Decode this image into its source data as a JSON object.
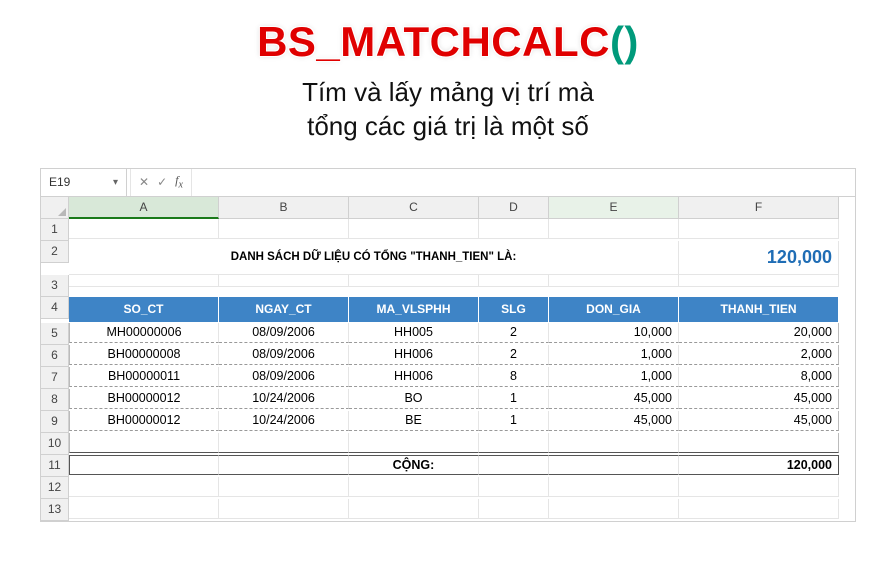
{
  "title": {
    "name": "BS_MATCHCALC",
    "paren": "()"
  },
  "subtitle_line1": "Tím và lấy mảng vị trí mà",
  "subtitle_line2": "tổng các giá trị là một số",
  "namebox": "E19",
  "caption": "DANH SÁCH DỮ LIỆU CÓ TỔNG \"THANH_TIEN\" LÀ:",
  "target_sum": "120,000",
  "columns": [
    "A",
    "B",
    "C",
    "D",
    "E",
    "F"
  ],
  "row_numbers": [
    "1",
    "2",
    "3",
    "4",
    "5",
    "6",
    "7",
    "8",
    "9",
    "10",
    "11",
    "12",
    "13"
  ],
  "headers": [
    "SO_CT",
    "NGAY_CT",
    "MA_VLSPHH",
    "SLG",
    "DON_GIA",
    "THANH_TIEN"
  ],
  "rows": [
    {
      "so_ct": "MH00000006",
      "ngay": "08/09/2006",
      "ma": "HH005",
      "slg": "2",
      "don_gia": "10,000",
      "tt": "20,000"
    },
    {
      "so_ct": "BH00000008",
      "ngay": "08/09/2006",
      "ma": "HH006",
      "slg": "2",
      "don_gia": "1,000",
      "tt": "2,000"
    },
    {
      "so_ct": "BH00000011",
      "ngay": "08/09/2006",
      "ma": "HH006",
      "slg": "8",
      "don_gia": "1,000",
      "tt": "8,000"
    },
    {
      "so_ct": "BH00000012",
      "ngay": "10/24/2006",
      "ma": "BO",
      "slg": "1",
      "don_gia": "45,000",
      "tt": "45,000"
    },
    {
      "so_ct": "BH00000012",
      "ngay": "10/24/2006",
      "ma": "BE",
      "slg": "1",
      "don_gia": "45,000",
      "tt": "45,000"
    }
  ],
  "total_label": "CỘNG:",
  "total_value": "120,000",
  "icons": {
    "times": "✕",
    "check": "✓"
  }
}
